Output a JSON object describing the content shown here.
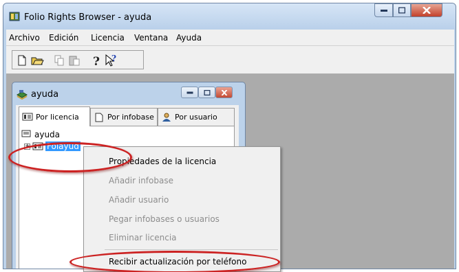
{
  "window": {
    "title": "Folio Rights Browser - ayuda",
    "icon": "folio-app-icon"
  },
  "menubar": {
    "items": [
      "Archivo",
      "Edición",
      "Licencia",
      "Ventana",
      "Ayuda"
    ]
  },
  "toolbar": {
    "buttons": [
      "new-icon",
      "open-icon",
      "copy-icon",
      "paste-icon",
      "help-icon",
      "context-help-icon"
    ]
  },
  "child_window": {
    "title": "ayuda",
    "tabs": [
      {
        "label": "Por licencia",
        "icon": "license-icon",
        "selected": true
      },
      {
        "label": "Por infobase",
        "icon": "document-icon",
        "selected": false
      },
      {
        "label": "Por usuario",
        "icon": "user-icon",
        "selected": false
      }
    ],
    "tree": {
      "root_label": "ayuda",
      "child_label": "Folayud",
      "expander": "+"
    }
  },
  "context_menu": {
    "items": [
      {
        "label": "Propiedades de la licencia",
        "enabled": true
      },
      {
        "label": "Añadir infobase",
        "enabled": false
      },
      {
        "label": "Añadir usuario",
        "enabled": false
      },
      {
        "label": "Pegar infobases o usuarios",
        "enabled": false
      },
      {
        "label": "Eliminar licencia",
        "enabled": false
      },
      {
        "label": "Recibir actualización por teléfono",
        "enabled": true
      }
    ]
  },
  "colors": {
    "highlight": "#cc2222",
    "selection": "#3399ff",
    "mdi_background": "#ababab"
  }
}
